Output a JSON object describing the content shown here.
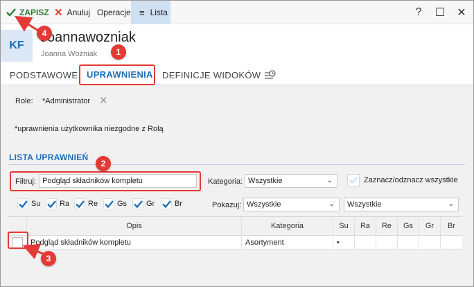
{
  "toolbar": {
    "save_label": "ZAPISZ",
    "cancel_label": "Anuluj",
    "operations_label": "Operacje",
    "list_label": "Lista",
    "help_glyph": "?",
    "maximize_glyph": "☐",
    "close_glyph": "✕"
  },
  "header": {
    "avatar_initials": "KF",
    "login": "Joannawozniak",
    "full_name": "Joanna Woźniak"
  },
  "tabs": [
    {
      "label": "PODSTAWOWE"
    },
    {
      "label": "UPRAWNIENIA",
      "active": true
    },
    {
      "label": "DEFINICJE WIDOKÓW"
    }
  ],
  "roles": {
    "label": "Role:",
    "value": "*Administrator"
  },
  "note": "*uprawnienia użytkownika niezgodne z Rolą",
  "section_title": "LISTA UPRAWNIEŃ",
  "filter": {
    "label": "Filtruj:",
    "value": "Podgląd składników kompletu"
  },
  "category": {
    "label": "Kategoria:",
    "value": "Wszystkie"
  },
  "toggle_all_label": "Zaznacz/odznacz wszystkie",
  "permission_flags": [
    {
      "label": "Su",
      "checked": true
    },
    {
      "label": "Ra",
      "checked": true
    },
    {
      "label": "Re",
      "checked": true
    },
    {
      "label": "Gs",
      "checked": true
    },
    {
      "label": "Gr",
      "checked": true
    },
    {
      "label": "Br",
      "checked": true
    }
  ],
  "show": {
    "label": "Pokazuj:",
    "value1": "Wszystkie",
    "value2": "Wszystkie"
  },
  "table": {
    "columns": [
      "Opis",
      "Kategoria",
      "Su",
      "Ra",
      "Re",
      "Gs",
      "Gr",
      "Br"
    ],
    "rows": [
      {
        "opis": "Podgląd składników kompletu",
        "kategoria": "Asortyment",
        "su": "•",
        "ra": "",
        "re": "",
        "gs": "",
        "gr": "",
        "br": "",
        "checked": false
      }
    ]
  },
  "annotations": [
    "1",
    "2",
    "3",
    "4"
  ],
  "colors": {
    "accent": "#1f6fb8",
    "save_green": "#2e7d32",
    "annotation_red": "#e53935"
  }
}
